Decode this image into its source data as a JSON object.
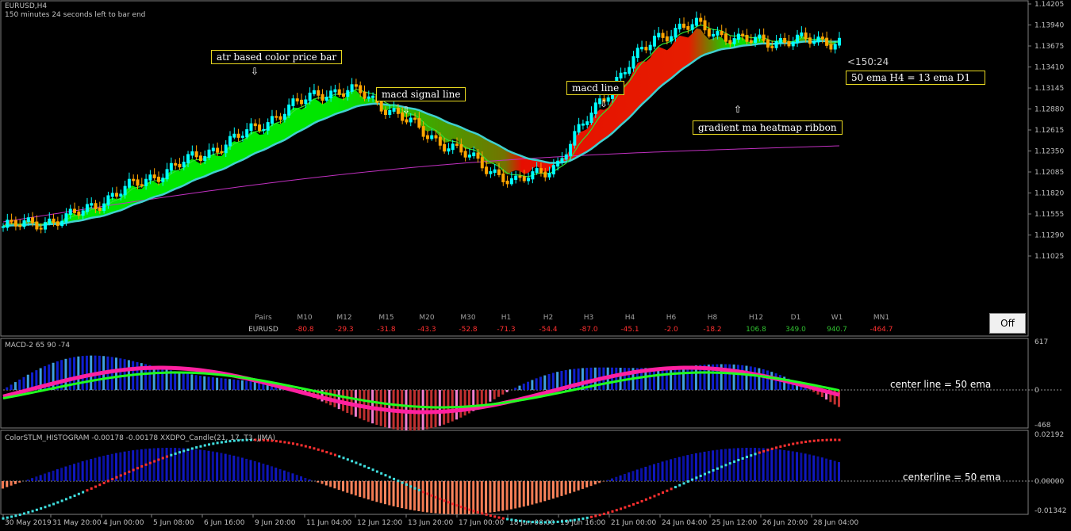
{
  "chart": {
    "symbol_tf": "EURUSD,H4",
    "countdown": "150 minutes 24 seconds left to bar end",
    "bar_timer": "<150:24",
    "price_ticks": [
      "1.14205",
      "1.13940",
      "1.13675",
      "1.13410",
      "1.13145",
      "1.12880",
      "1.12615",
      "1.12350",
      "1.12085",
      "1.11820",
      "1.11555",
      "1.11290",
      "1.11025"
    ],
    "x_ticks": [
      "30 May 2019",
      "31 May 20:00",
      "4 Jun 00:00",
      "5 Jun 08:00",
      "6 Jun 16:00",
      "9 Jun 20:00",
      "11 Jun 04:00",
      "12 Jun 12:00",
      "13 Jun 20:00",
      "17 Jun 00:00",
      "18 Jun 08:00",
      "19 Jun 16:00",
      "21 Jun 00:00",
      "24 Jun 04:00",
      "25 Jun 12:00",
      "26 Jun 20:00",
      "28 Jun 04:00"
    ],
    "callouts": {
      "atr": "atr based color price bar",
      "signal": "macd signal line",
      "macdline": "macd line",
      "ema": "50 ema  H4 = 13 ema D1",
      "ribbon": "gradient ma heatmap ribbon"
    },
    "arrow_down": "⇩",
    "arrow_up": "⇧",
    "colors": {
      "bull": "#00ffff",
      "bear": "#ffa500",
      "ribbon_up": "#00ff00",
      "ribbon_down": "#ff0000",
      "ma_slow": "#c030c0",
      "ma_fast": "#40d0d0"
    }
  },
  "mtf_table": {
    "pairs_label": "Pairs",
    "symbol": "EURUSD",
    "timeframes": [
      "M10",
      "M12",
      "M15",
      "M20",
      "M30",
      "H1",
      "H2",
      "H3",
      "H4",
      "H6",
      "H8",
      "H12",
      "D1",
      "W1",
      "MN1"
    ],
    "values": [
      "-80.8",
      "-29.3",
      "-31.8",
      "-43.3",
      "-52.8",
      "-71.3",
      "-54.4",
      "-87.0",
      "-45.1",
      "-2.0",
      "-18.2",
      "106.8",
      "349.0",
      "940.7",
      "-464.7"
    ],
    "value_colors": [
      "#ff3030",
      "#ff3030",
      "#ff3030",
      "#ff3030",
      "#ff3030",
      "#ff3030",
      "#ff3030",
      "#ff3030",
      "#ff3030",
      "#ff3030",
      "#ff3030",
      "#30c030",
      "#30c030",
      "#30c030",
      "#ff3030"
    ]
  },
  "off_button": "Off",
  "macd_panel": {
    "title": "MACD-2 65 90 -74",
    "ticks": [
      "617",
      "0",
      "-468"
    ],
    "note": "center line = 50 ema"
  },
  "stlm_panel": {
    "title": "ColorSTLM_HISTOGRAM -0.00178 -0.00178 XXDPO_Candle(21, 17, T3, JJMA)",
    "ticks": [
      "0.02192",
      "0.00000",
      "-0.01342"
    ],
    "note": "centerline = 50 ema"
  }
}
